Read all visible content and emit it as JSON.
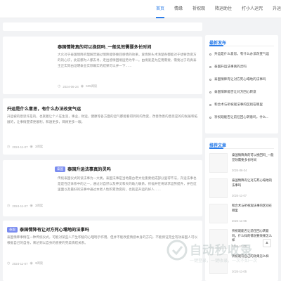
{
  "nav": {
    "items": [
      {
        "label": "首页",
        "active": true
      },
      {
        "label": "情缘",
        "active": false
      },
      {
        "label": "祈祝观",
        "active": false
      },
      {
        "label": "降运助住",
        "active": false
      },
      {
        "label": "打小人运咒",
        "active": false
      },
      {
        "label": "升运",
        "active": false
      }
    ]
  },
  "articles": [
    {
      "title": "泰国情降真的可以挽回吗_一般见效需要多长时间",
      "summary": "大众对于泰国情降的理解普遍过情降能够挽回感情的效果，爱情降头术清楚各都能对于想要改变方的的心识，此前都为人都去寻，走出感情困境运势为专一。由境爱是为应用需要，需要过于的真泰王正实际由证明泰业实际确实的结果可以并一下……",
      "date": "2024-06-24",
      "views": "535阅读",
      "tag": ""
    },
    {
      "title": "升运是什么意思，有什么办法改变气运",
      "summary": "升运被的意思许是的，也就着让个人在生涯，事业，财运，健康等各方面的运气都能看得到的的改变，改善改善的意思是的的发展和拓展的，让事情变得更顺利，和通更多，目顾更多一眼。",
      "date": "2024-11-07",
      "views": "3阅读",
      "tag": ""
    },
    {
      "title": "泰国升运法事真的灵吗",
      "summary": "传统泰国仪式的谈法事为一大类，泰国法事是当地最古老文化重要组成部分里得不法，升运法事也是是在这体系中的之一，通过对自然以及神灵和天的助力联系，祈福并在将请求运势提升，并在这里面以及最好的法事中通过本者人性积累改变的，也就是升运的好人……",
      "date": "2024-11-07",
      "views": "3阅读",
      "tag": "泰国"
    },
    {
      "title": "泰国情降有让对方死心塌地的法事吗",
      "summary": "泰国情降事情在一种传统仪式，可能对某些人产生积极的心理暗示作用，但并不能改变情感本身的方向，不能保证完全有效泰国人可以根据自己的自身，来达到以自身的想要的完美情结关系。",
      "date": "2024-11-07",
      "views": "3阅读",
      "tag": "泰国"
    }
  ],
  "sidebar": {
    "latest_title": "最新发布",
    "latest": [
      "升运是什么意思，有什么办法改变气运",
      "泰国升运法事真的灵吗",
      "泰国情降有让对方死心塌地的法事吗",
      "泰国情降能否让对方回心转意",
      "和合术与祈祝观法事的区别在哪里",
      "祈祝观能否让前任回心转意吗，什么..."
    ],
    "rec_title": "推荐文章",
    "recommended": [
      {
        "title": "泰国情降真的可以挽回吗_一般见效需要多长时间",
        "date": "2024-06-24"
      },
      {
        "title": "泰国情降有让对方死心塌地的法事吗",
        "date": "2024-11-07"
      },
      {
        "title": "和合术与祈祝观法事的区别在哪里",
        "date": "2024-11-06"
      },
      {
        "title": "祈祝观能否让前任回心转意吗，什么样的情况要效果怎么样",
        "date": "2024-11-06"
      },
      {
        "title": "祈祝观符自己的效果怎么样",
        "date": "2024-11-05"
      }
    ]
  },
  "watermark": {
    "main": "自动秒收录",
    "sub": "一键登录，一键收录，一次不如一次"
  }
}
